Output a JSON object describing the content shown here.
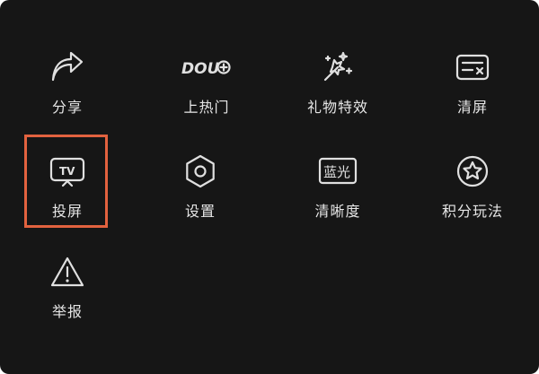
{
  "menu": {
    "items": [
      {
        "id": "share",
        "label": "分享",
        "icon": "share-arrow-icon"
      },
      {
        "id": "hot",
        "label": "上热门",
        "icon": "dou-plus-icon",
        "icon_text": "DOU"
      },
      {
        "id": "gift-effects",
        "label": "礼物特效",
        "icon": "magic-gift-icon"
      },
      {
        "id": "clear-screen",
        "label": "清屏",
        "icon": "clear-screen-icon"
      },
      {
        "id": "cast",
        "label": "投屏",
        "icon": "tv-cast-icon",
        "icon_text": "TV"
      },
      {
        "id": "settings",
        "label": "设置",
        "icon": "hexagon-settings-icon"
      },
      {
        "id": "resolution",
        "label": "清晰度",
        "icon": "resolution-badge-icon",
        "icon_text": "蓝光"
      },
      {
        "id": "points",
        "label": "积分玩法",
        "icon": "star-circle-icon"
      },
      {
        "id": "report",
        "label": "举报",
        "icon": "warning-triangle-icon"
      }
    ],
    "highlighted_item": "cast"
  },
  "colors": {
    "background": "#161616",
    "icon": "#e0e0e0",
    "label": "#e6e6e6",
    "highlight": "#e2623f"
  }
}
